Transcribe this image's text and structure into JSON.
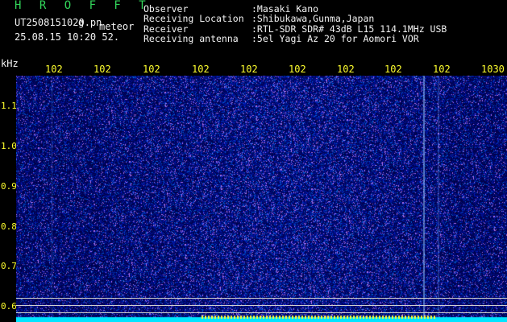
{
  "header": {
    "brand": "H R O F F T",
    "file_name": "UT2508151020.pn",
    "file_ext": "g",
    "tag": "meteor",
    "timestamp": "25.08.15 10:20   52.",
    "info": [
      {
        "label": "Observer",
        "value": ":Masaki Kano"
      },
      {
        "label": "Receiving Location",
        "value": ":Shibukawa,Gunma,Japan"
      },
      {
        "label": "Receiver",
        "value": ":RTL-SDR SDR# 43dB L15 114.1MHz USB"
      },
      {
        "label": "Receiving antenna",
        "value": ":5el Yagi Az 20 for Aomori VOR"
      }
    ]
  },
  "spectrogram": {
    "unit": "kHz",
    "x_ticks": [
      "102",
      "102",
      "102",
      "102",
      "102",
      "102",
      "102",
      "102",
      "102",
      "1030"
    ],
    "y_ticks": [
      "1.1",
      "1.0",
      "0.9",
      "0.8",
      "0.7",
      "0.6"
    ],
    "colors": {
      "background": "#000000",
      "label": "#ffff2e",
      "text": "#f2f2f2",
      "brand": "#32d65a",
      "noise_base": "#00006e",
      "baseline": "#00e5ff"
    }
  }
}
